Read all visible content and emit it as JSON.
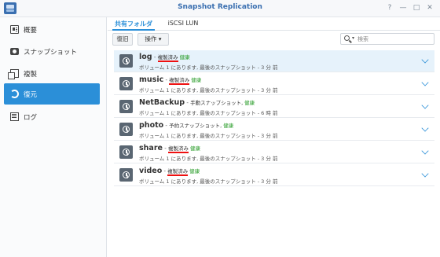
{
  "window": {
    "title": "Snapshot Replication",
    "help_glyph": "?",
    "minimize_glyph": "—",
    "maximize_glyph": "□",
    "close_glyph": "✕"
  },
  "sidebar": {
    "items": [
      {
        "label": "概要",
        "icon": "overview-icon"
      },
      {
        "label": "スナップショット",
        "icon": "camera-icon"
      },
      {
        "label": "複製",
        "icon": "copy-icon"
      },
      {
        "label": "復元",
        "icon": "restore-icon",
        "active": true
      },
      {
        "label": "ログ",
        "icon": "log-icon"
      }
    ]
  },
  "tabs": [
    {
      "label": "共有フォルダ",
      "active": true
    },
    {
      "label": "iSCSI LUN",
      "active": false
    }
  ],
  "toolbar": {
    "restore_label": "復旧",
    "action_label": "操作 ▾",
    "search_placeholder": "検索"
  },
  "colors": {
    "accent": "#2b8fd8",
    "health": "#2a9d2a",
    "underline": "#ee1111"
  },
  "rows": [
    {
      "name": "log",
      "dash": " - ",
      "status": "複製済み",
      "health": "健康",
      "desc": "ボリューム 1 にあります, 最後のスナップショット - 3 分 前"
    },
    {
      "name": "music",
      "dash": " - ",
      "status": "複製済み",
      "health": "健康",
      "desc": "ボリューム 1 にあります, 最後のスナップショット - 3 分 前"
    },
    {
      "name": "NetBackup",
      "dash": " - ",
      "status": "手動スナップショット,",
      "health": "健康",
      "desc": "ボリューム 1 にあります, 最後のスナップショット - 6 時 前"
    },
    {
      "name": "photo",
      "dash": " - ",
      "status": "予約スナップショット,",
      "health": "健康",
      "desc": "ボリューム 1 にあります, 最後のスナップショット - 3 分 前"
    },
    {
      "name": "share",
      "dash": " - ",
      "status": "複製済み",
      "health": "健康",
      "desc": "ボリューム 1 にあります, 最後のスナップショット - 3 分 前"
    },
    {
      "name": "video",
      "dash": " - ",
      "status": "複製済み",
      "health": "健康",
      "desc": "ボリューム 1 にあります, 最後のスナップショット - 3 分 前"
    }
  ]
}
